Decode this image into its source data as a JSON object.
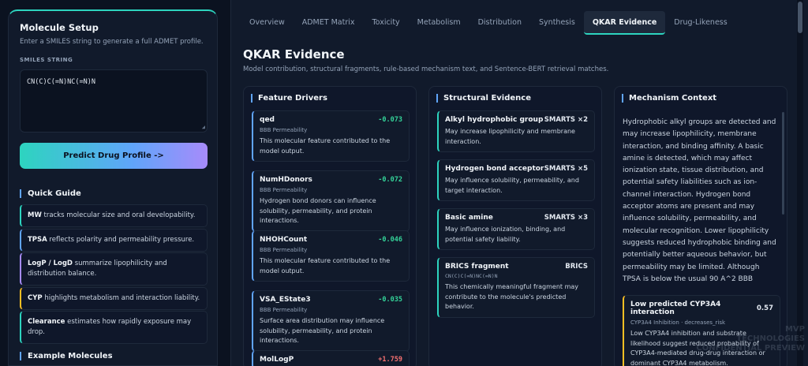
{
  "sidebar": {
    "title": "Molecule Setup",
    "subtitle": "Enter a SMILES string to generate a full ADMET profile.",
    "smiles_label": "SMILES STRING",
    "smiles_value": "CN(C)C(=N)NC(=N)N",
    "predict_button": "Predict Drug Profile ->",
    "quick_guide_title": "Quick Guide",
    "quick_guide": [
      {
        "key": "MW",
        "text": " tracks molecular size and oral developability."
      },
      {
        "key": "TPSA",
        "text": " reflects polarity and permeability pressure."
      },
      {
        "key": "LogP / LogD",
        "text": " summarize lipophilicity and distribution balance."
      },
      {
        "key": "CYP",
        "text": " highlights metabolism and interaction liability."
      },
      {
        "key": "Clearance",
        "text": " estimates how rapidly exposure may drop."
      }
    ],
    "examples_title": "Example Molecules"
  },
  "tabs": [
    "Overview",
    "ADMET Matrix",
    "Toxicity",
    "Metabolism",
    "Distribution",
    "Synthesis",
    "QKAR Evidence",
    "Drug-Likeness"
  ],
  "active_tab": "QKAR Evidence",
  "page": {
    "title": "QKAR Evidence",
    "subtitle": "Model contribution, structural fragments, rule-based mechanism text, and Sentence-BERT retrieval matches."
  },
  "feature_drivers": {
    "title": "Feature Drivers",
    "items": [
      {
        "name": "qed",
        "value": "-0.073",
        "tag": "BBB Permeability",
        "desc": "This molecular feature contributed to the model output."
      },
      {
        "name": "NumHDonors",
        "value": "-0.072",
        "tag": "BBB Permeability",
        "desc": "Hydrogen bond donors can influence solubility, permeability, and protein interactions."
      },
      {
        "name": "NHOHCount",
        "value": "-0.046",
        "tag": "BBB Permeability",
        "desc": "This molecular feature contributed to the model output."
      },
      {
        "name": "VSA_EState3",
        "value": "-0.035",
        "tag": "BBB Permeability",
        "desc": "Surface area distribution may influence solubility, permeability, and protein interactions."
      },
      {
        "name": "MolLogP",
        "value": "+1.759",
        "tag": "",
        "desc": ""
      }
    ]
  },
  "structural_evidence": {
    "title": "Structural Evidence",
    "items": [
      {
        "name": "Alkyl hydrophobic group",
        "badge": "SMARTS ×2",
        "desc": "May increase lipophilicity and membrane interaction."
      },
      {
        "name": "Hydrogen bond acceptor",
        "badge": "SMARTS ×5",
        "desc": "May influence solubility, permeability, and target interaction."
      },
      {
        "name": "Basic amine",
        "badge": "SMARTS ×3",
        "desc": "May influence ionization, binding, and potential safety liability."
      },
      {
        "name": "BRICS fragment",
        "badge": "BRICS",
        "smiles": "CN(C)C(=N)NC(=N)N",
        "desc": "This chemically meaningful fragment may contribute to the molecule's predicted behavior."
      }
    ]
  },
  "mechanism": {
    "title": "Mechanism Context",
    "text": "Hydrophobic alkyl groups are detected and may increase lipophilicity, membrane interaction, and binding affinity. A basic amine is detected, which may affect ionization state, tissue distribution, and potential safety liabilities such as ion-channel interaction. Hydrogen bond acceptor atoms are present and may influence solubility, permeability, and molecular recognition. Lower lipophilicity suggests reduced hydrophobic binding and potentially better aqueous behavior, but permeability may be limited. Although TPSA is below the usual 90 A^2 BBB",
    "inhibition": {
      "title": "Low predicted CYP3A4 interaction",
      "value": "0.57",
      "tag": "CYP3A4 Inhibition · decreases_risk",
      "desc": "Low CYP3A4 inhibition and substrate likelihood suggest reduced probability of CYP3A4-mediated drug-drug interaction or dominant CYP3A4 metabolism."
    }
  },
  "watermark": [
    "MVP",
    "TECHNOLOGIES",
    "CONFIDENTIAL PREVIEW"
  ],
  "colors": {
    "accent_teal": "#2dd4bf",
    "accent_blue": "#60a5fa",
    "accent_purple": "#a78bfa",
    "negative": "#34d399",
    "positive": "#f87171"
  }
}
